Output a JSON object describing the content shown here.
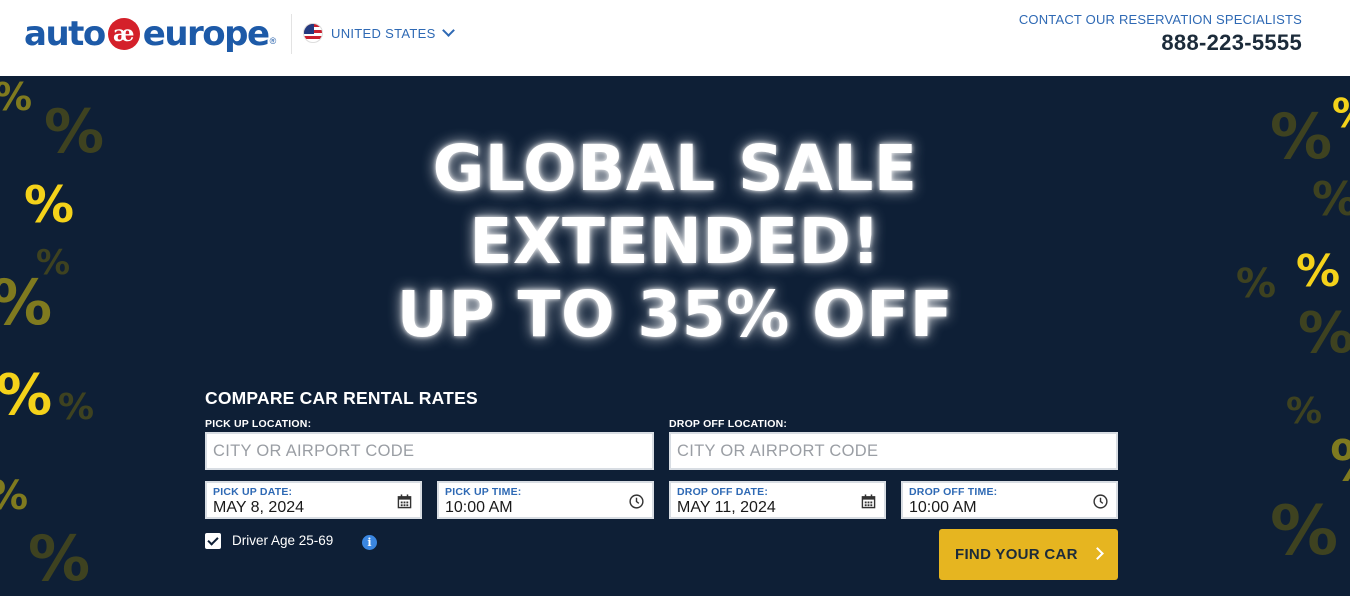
{
  "header": {
    "logo_left": "auto",
    "logo_mark": "æ",
    "logo_right": "europe",
    "logo_reg": "®",
    "country": "UNITED STATES",
    "contact_label": "CONTACT OUR RESERVATION SPECIALISTS",
    "phone": "888-223-5555"
  },
  "hero": {
    "headline_line1": "GLOBAL SALE",
    "headline_line2": "EXTENDED!",
    "headline_line3": "UP TO 35% OFF",
    "percent_glyph": "%"
  },
  "form": {
    "title": "COMPARE CAR RENTAL RATES",
    "pickup_location_label": "PICK UP LOCATION:",
    "pickup_location_placeholder": "CITY OR AIRPORT CODE",
    "dropoff_location_label": "DROP OFF LOCATION:",
    "dropoff_location_placeholder": "CITY OR AIRPORT CODE",
    "pickup_date_label": "PICK UP DATE:",
    "pickup_date_value": "MAY 8, 2024",
    "pickup_time_label": "PICK UP TIME:",
    "pickup_time_value": "10:00 AM",
    "dropoff_date_label": "DROP OFF DATE:",
    "dropoff_date_value": "MAY 11, 2024",
    "dropoff_time_label": "DROP OFF TIME:",
    "dropoff_time_value": "10:00 AM",
    "driver_age_label": "Driver Age 25-69",
    "driver_age_checked": true,
    "info_glyph": "i",
    "find_button": "FIND YOUR CAR"
  },
  "colors": {
    "brand_blue": "#1d5aa8",
    "brand_red": "#d4202a",
    "hero_bg": "#0e1f36",
    "accent_yellow": "#e6b520",
    "percent_yellow": "#f4d21a"
  },
  "icons": [
    "us-flag-icon",
    "chevron-down-icon",
    "calendar-icon",
    "clock-icon",
    "checkbox-icon",
    "info-icon",
    "chevron-right-icon"
  ]
}
